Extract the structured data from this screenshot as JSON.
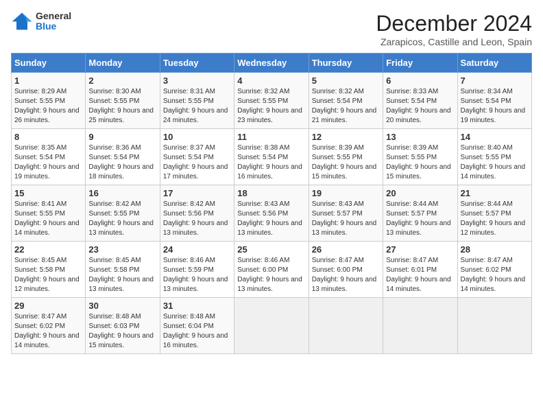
{
  "header": {
    "logo_general": "General",
    "logo_blue": "Blue",
    "month_title": "December 2024",
    "subtitle": "Zarapicos, Castille and Leon, Spain"
  },
  "days_of_week": [
    "Sunday",
    "Monday",
    "Tuesday",
    "Wednesday",
    "Thursday",
    "Friday",
    "Saturday"
  ],
  "weeks": [
    [
      {
        "day": "1",
        "sunrise": "8:29 AM",
        "sunset": "5:55 PM",
        "daylight": "9 hours and 26 minutes."
      },
      {
        "day": "2",
        "sunrise": "8:30 AM",
        "sunset": "5:55 PM",
        "daylight": "9 hours and 25 minutes."
      },
      {
        "day": "3",
        "sunrise": "8:31 AM",
        "sunset": "5:55 PM",
        "daylight": "9 hours and 24 minutes."
      },
      {
        "day": "4",
        "sunrise": "8:32 AM",
        "sunset": "5:55 PM",
        "daylight": "9 hours and 23 minutes."
      },
      {
        "day": "5",
        "sunrise": "8:32 AM",
        "sunset": "5:54 PM",
        "daylight": "9 hours and 21 minutes."
      },
      {
        "day": "6",
        "sunrise": "8:33 AM",
        "sunset": "5:54 PM",
        "daylight": "9 hours and 20 minutes."
      },
      {
        "day": "7",
        "sunrise": "8:34 AM",
        "sunset": "5:54 PM",
        "daylight": "9 hours and 19 minutes."
      }
    ],
    [
      {
        "day": "8",
        "sunrise": "8:35 AM",
        "sunset": "5:54 PM",
        "daylight": "9 hours and 19 minutes."
      },
      {
        "day": "9",
        "sunrise": "8:36 AM",
        "sunset": "5:54 PM",
        "daylight": "9 hours and 18 minutes."
      },
      {
        "day": "10",
        "sunrise": "8:37 AM",
        "sunset": "5:54 PM",
        "daylight": "9 hours and 17 minutes."
      },
      {
        "day": "11",
        "sunrise": "8:38 AM",
        "sunset": "5:54 PM",
        "daylight": "9 hours and 16 minutes."
      },
      {
        "day": "12",
        "sunrise": "8:39 AM",
        "sunset": "5:55 PM",
        "daylight": "9 hours and 15 minutes."
      },
      {
        "day": "13",
        "sunrise": "8:39 AM",
        "sunset": "5:55 PM",
        "daylight": "9 hours and 15 minutes."
      },
      {
        "day": "14",
        "sunrise": "8:40 AM",
        "sunset": "5:55 PM",
        "daylight": "9 hours and 14 minutes."
      }
    ],
    [
      {
        "day": "15",
        "sunrise": "8:41 AM",
        "sunset": "5:55 PM",
        "daylight": "9 hours and 14 minutes."
      },
      {
        "day": "16",
        "sunrise": "8:42 AM",
        "sunset": "5:55 PM",
        "daylight": "9 hours and 13 minutes."
      },
      {
        "day": "17",
        "sunrise": "8:42 AM",
        "sunset": "5:56 PM",
        "daylight": "9 hours and 13 minutes."
      },
      {
        "day": "18",
        "sunrise": "8:43 AM",
        "sunset": "5:56 PM",
        "daylight": "9 hours and 13 minutes."
      },
      {
        "day": "19",
        "sunrise": "8:43 AM",
        "sunset": "5:57 PM",
        "daylight": "9 hours and 13 minutes."
      },
      {
        "day": "20",
        "sunrise": "8:44 AM",
        "sunset": "5:57 PM",
        "daylight": "9 hours and 13 minutes."
      },
      {
        "day": "21",
        "sunrise": "8:44 AM",
        "sunset": "5:57 PM",
        "daylight": "9 hours and 12 minutes."
      }
    ],
    [
      {
        "day": "22",
        "sunrise": "8:45 AM",
        "sunset": "5:58 PM",
        "daylight": "9 hours and 12 minutes."
      },
      {
        "day": "23",
        "sunrise": "8:45 AM",
        "sunset": "5:58 PM",
        "daylight": "9 hours and 13 minutes."
      },
      {
        "day": "24",
        "sunrise": "8:46 AM",
        "sunset": "5:59 PM",
        "daylight": "9 hours and 13 minutes."
      },
      {
        "day": "25",
        "sunrise": "8:46 AM",
        "sunset": "6:00 PM",
        "daylight": "9 hours and 13 minutes."
      },
      {
        "day": "26",
        "sunrise": "8:47 AM",
        "sunset": "6:00 PM",
        "daylight": "9 hours and 13 minutes."
      },
      {
        "day": "27",
        "sunrise": "8:47 AM",
        "sunset": "6:01 PM",
        "daylight": "9 hours and 14 minutes."
      },
      {
        "day": "28",
        "sunrise": "8:47 AM",
        "sunset": "6:02 PM",
        "daylight": "9 hours and 14 minutes."
      }
    ],
    [
      {
        "day": "29",
        "sunrise": "8:47 AM",
        "sunset": "6:02 PM",
        "daylight": "9 hours and 14 minutes."
      },
      {
        "day": "30",
        "sunrise": "8:48 AM",
        "sunset": "6:03 PM",
        "daylight": "9 hours and 15 minutes."
      },
      {
        "day": "31",
        "sunrise": "8:48 AM",
        "sunset": "6:04 PM",
        "daylight": "9 hours and 16 minutes."
      },
      null,
      null,
      null,
      null
    ]
  ],
  "labels": {
    "sunrise": "Sunrise:",
    "sunset": "Sunset:",
    "daylight": "Daylight:"
  }
}
